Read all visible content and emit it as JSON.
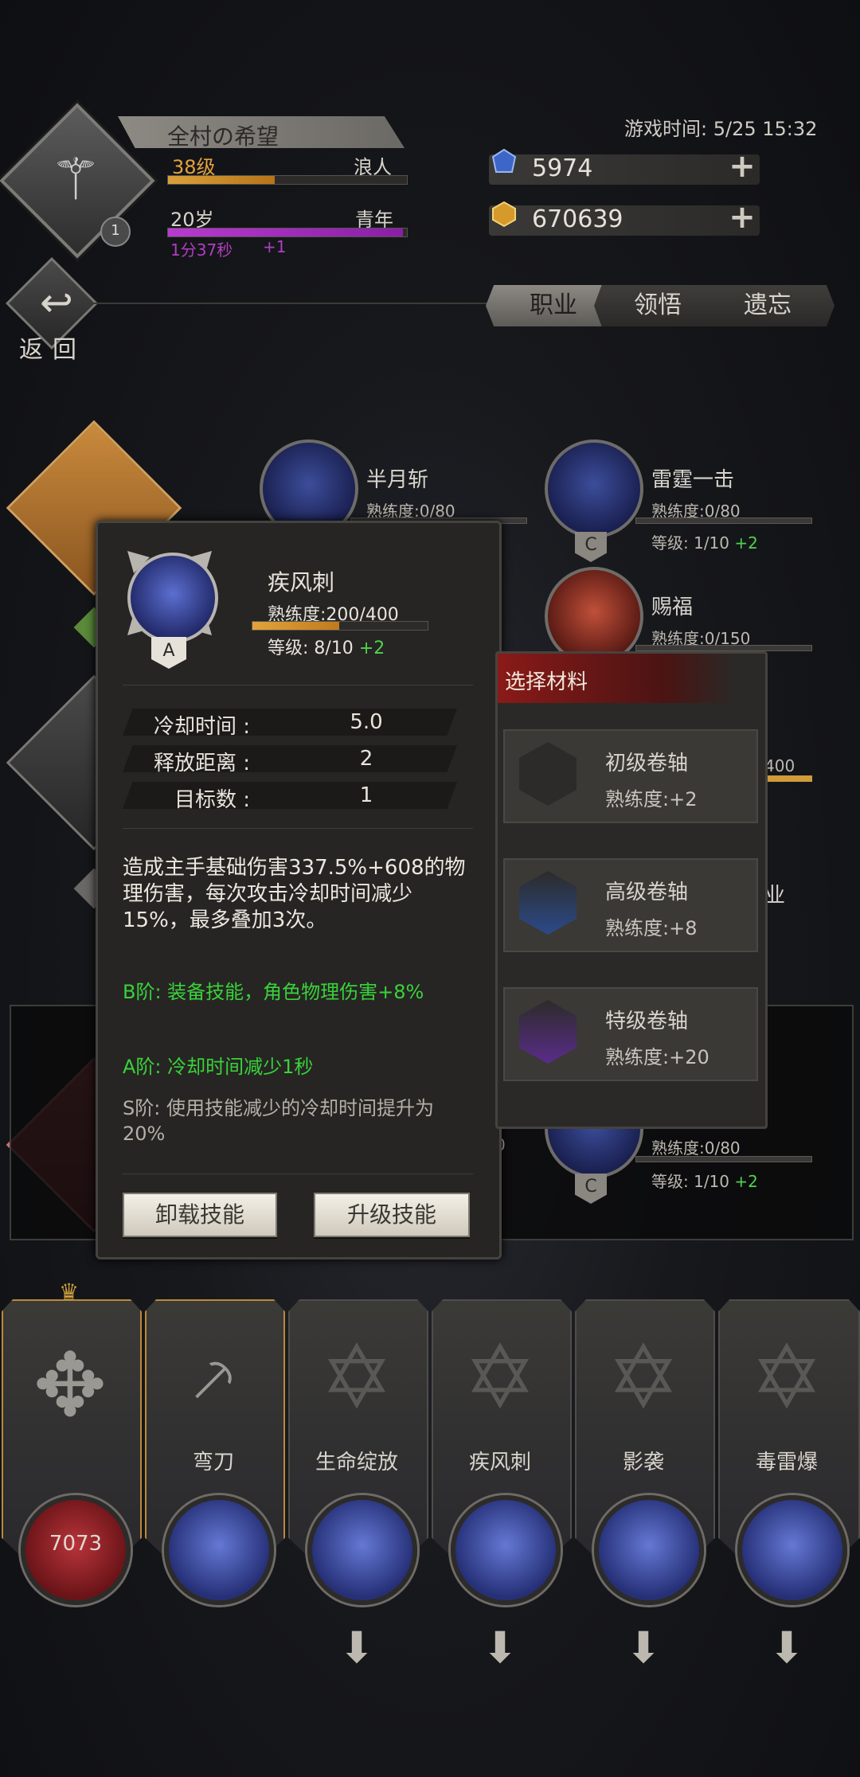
{
  "player": {
    "name": "全村の希望",
    "level": "38级",
    "class": "浪人",
    "level_progress": 0.45,
    "age": "20岁",
    "stage": "青年",
    "age_progress": 0.99,
    "timer": "1分37秒",
    "timer_bonus": "+1",
    "emblem_badge": "1"
  },
  "game_time": "游戏时间: 5/25 15:32",
  "currency": {
    "gems": "5974",
    "gold": "670639"
  },
  "back": {
    "label": "返回"
  },
  "tabs": [
    "职业",
    "领悟",
    "遗忘"
  ],
  "skills_bg": [
    {
      "name": "半月斩",
      "prof": "熟练度:0/80"
    },
    {
      "name": "雷霆一击",
      "prof": "熟练度:0/80",
      "level": "等级: 1/10",
      "bonus": "+2",
      "grade": "C"
    },
    {
      "name": "赐福",
      "prof": "熟练度:0/150"
    },
    {
      "prof_partial": "400"
    },
    {
      "name_partial": "业"
    },
    {
      "prof_left_partial": "0",
      "prof": "熟练度:0/80",
      "level": "等级: 1/10",
      "bonus": "+2",
      "grade": "C"
    }
  ],
  "detail": {
    "title": "疾风刺",
    "prof": "熟练度:200/400",
    "prof_progress": 0.5,
    "level": "等级: 8/10",
    "level_bonus": "+2",
    "grade": "A",
    "stats": [
      {
        "label": "冷却时间 :",
        "value": "5.0"
      },
      {
        "label": "释放距离 :",
        "value": "2"
      },
      {
        "label": "目标数 :",
        "value": "1"
      }
    ],
    "description": "造成主手基础伤害337.5%+608的物理伤害，每次攻击冷却时间减少15%，最多叠加3次。",
    "tier_b": "B阶: 装备技能，角色物理伤害+8%",
    "tier_a": "A阶: 冷却时间减少1秒",
    "tier_s": "S阶: 使用技能减少的冷却时间提升为20%",
    "unload_button": "卸载技能",
    "upgrade_button": "升级技能"
  },
  "materials": {
    "title": "选择材料",
    "items": [
      {
        "name": "初级卷轴",
        "gain": "熟练度:+2",
        "tier_color": "#3a3936"
      },
      {
        "name": "高级卷轴",
        "gain": "熟练度:+8",
        "tier_color": "#2c4a8a"
      },
      {
        "name": "特级卷轴",
        "gain": "熟练度:+20",
        "tier_color": "#5a2c8a"
      }
    ]
  },
  "slots": [
    {
      "label": "",
      "value": "7073"
    },
    {
      "label": "弯刀"
    },
    {
      "label": "生命绽放"
    },
    {
      "label": "疾风刺"
    },
    {
      "label": "影袭"
    },
    {
      "label": "毒雷爆"
    }
  ],
  "colors": {
    "xp_bar": "#d9a03a",
    "age_bar": "#b83ad0",
    "positive_green": "#39d23a",
    "material_header": "#8a1a18"
  }
}
